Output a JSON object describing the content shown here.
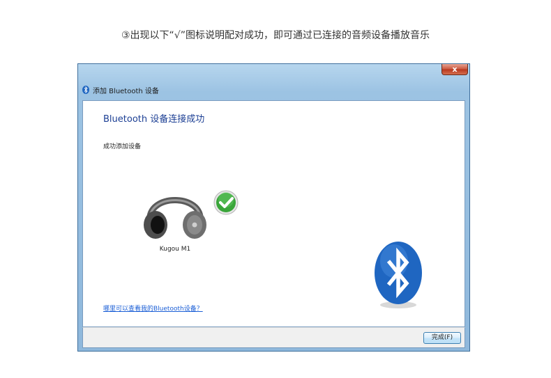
{
  "caption": "③出现以下“√”图标说明配对成功，即可通过已连接的音频设备播放音乐",
  "window": {
    "title": "添加 Bluetooth 设备",
    "close_label": "x",
    "heading": "Bluetooth 设备连接成功",
    "subtext": "成功添加设备",
    "device": {
      "name": "Kugou M1",
      "icon": "headphones-icon",
      "status_icon": "checkmark-icon"
    },
    "help_link": "哪里可以查看我的Bluetooth设备？",
    "finish_button": "完成(F)"
  },
  "colors": {
    "heading": "#1c3f94",
    "link": "#1a5ed6",
    "bluetooth_brand": "#1f66c1",
    "check_green": "#3aa53a"
  }
}
